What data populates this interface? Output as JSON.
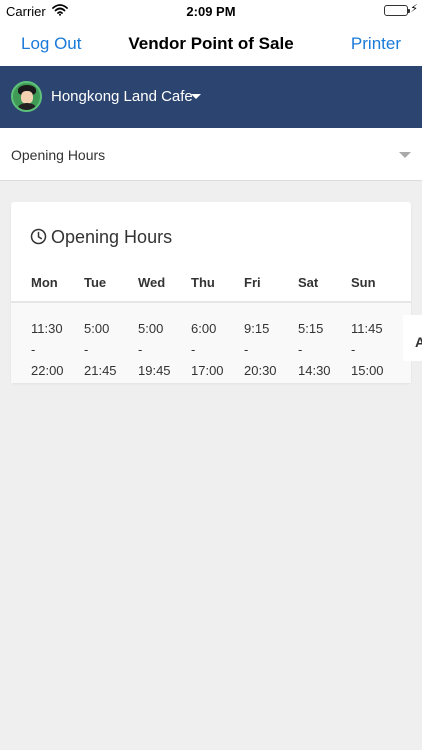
{
  "status_bar": {
    "carrier": "Carrier",
    "time": "2:09 PM"
  },
  "nav": {
    "left": "Log Out",
    "title": "Vendor Point of Sale",
    "right": "Printer"
  },
  "vendor": {
    "name": "Hongkong Land Cafe"
  },
  "section": {
    "selected": "Opening Hours"
  },
  "card": {
    "title": "Opening Hours",
    "days": [
      "Mon",
      "Tue",
      "Wed",
      "Thu",
      "Fri",
      "Sat",
      "Sun"
    ],
    "hours": [
      {
        "open": "11:30",
        "sep": "-",
        "close": "22:00"
      },
      {
        "open": "5:00",
        "sep": "-",
        "close": "21:45"
      },
      {
        "open": "5:00",
        "sep": "-",
        "close": "19:45"
      },
      {
        "open": "6:00",
        "sep": "-",
        "close": "17:00"
      },
      {
        "open": "9:15",
        "sep": "-",
        "close": "20:30"
      },
      {
        "open": "5:15",
        "sep": "-",
        "close": "14:30"
      },
      {
        "open": "11:45",
        "sep": "-",
        "close": "15:00"
      }
    ],
    "overflow_char": "A"
  },
  "colors": {
    "accent": "#1a7ad9",
    "vendor_bar": "#2c4570",
    "background": "#efefef"
  },
  "icons": {
    "wifi": "wifi-icon",
    "clock": "clock-icon",
    "caret": "caret-down-icon"
  }
}
